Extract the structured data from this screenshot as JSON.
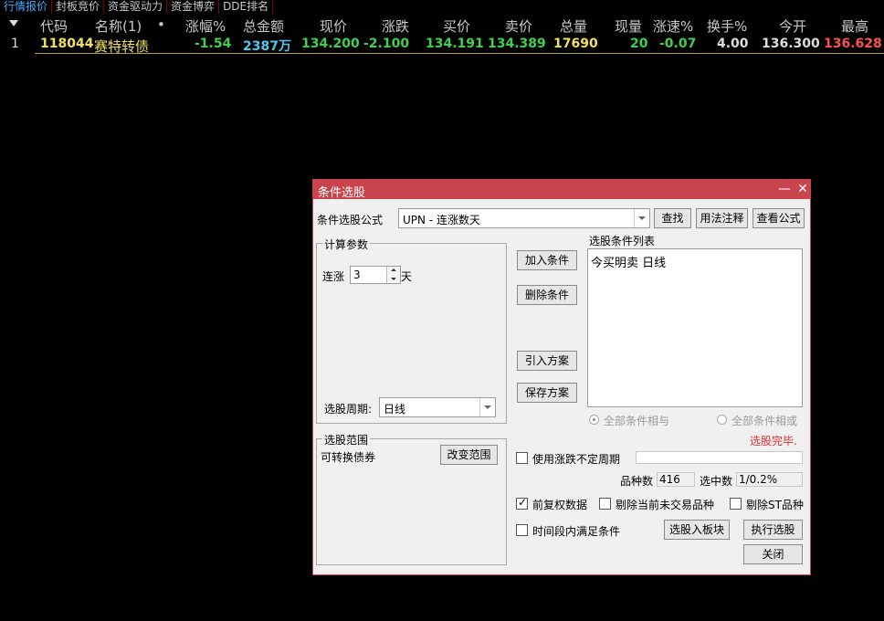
{
  "tabs": [
    "行情报价",
    "封板竞价",
    "资金驱动力",
    "资金博弈",
    "DDE排名"
  ],
  "colors": {
    "active_tab": "#44aaff",
    "title_bar": "#c9444c",
    "header_text": "#c8c8c8"
  },
  "quote_table": {
    "headers": [
      "代码",
      "名称(1)",
      "•",
      "涨幅%",
      "总金额",
      "现价",
      "涨跌",
      "买价",
      "卖价",
      "总量",
      "现量",
      "涨速%",
      "换手%",
      "今开",
      "最高"
    ],
    "row": {
      "index": "1",
      "code": "118044",
      "name": "赛特转债",
      "change_pct": "-1.54",
      "amount": "2387万",
      "price": "134.200",
      "change": "-2.100",
      "bid": "134.191",
      "ask": "134.389",
      "volume": "17690",
      "cur_vol": "20",
      "speed": "-0.07",
      "turnover": "4.00",
      "open": "136.300",
      "high": "136.628"
    }
  },
  "dialog": {
    "title": "条件选股",
    "formula_label": "条件选股公式",
    "formula_value": "UPN  -  连涨数天",
    "buttons": {
      "find": "查找",
      "usage": "用法注释",
      "view_formula": "查看公式",
      "add_condition": "加入条件",
      "delete_condition": "删除条件",
      "import_plan": "引入方案",
      "save_plan": "保存方案",
      "change_range": "改变范围",
      "to_block": "选股入板块",
      "execute": "执行选股",
      "close": "关闭"
    },
    "calc_params": {
      "title": "计算参数",
      "param_label": "连涨",
      "param_value": "3",
      "param_unit": "天",
      "period_label": "选股周期:",
      "period_value": "日线"
    },
    "range": {
      "title": "选股范围",
      "value": "可转换债券"
    },
    "condition_list": {
      "title": "选股条件列表",
      "items": [
        "今买明卖 日线"
      ]
    },
    "logic": {
      "and_label": "全部条件相与",
      "or_label": "全部条件相或",
      "selected": "and"
    },
    "status": "选股完毕.",
    "variable_period": {
      "label": "使用涨跌不定周期",
      "checked": false
    },
    "counts": {
      "total_label": "品种数",
      "total_value": "416",
      "selected_label": "选中数",
      "selected_value": "1/0.2%"
    },
    "options": {
      "fq": {
        "label": "前复权数据",
        "checked": true
      },
      "exclude_no_trade": {
        "label": "剔除当前未交易品种",
        "checked": false
      },
      "exclude_st": {
        "label": "剔除ST品种",
        "checked": false
      },
      "time_range": {
        "label": "时间段内满足条件",
        "checked": false
      }
    }
  }
}
